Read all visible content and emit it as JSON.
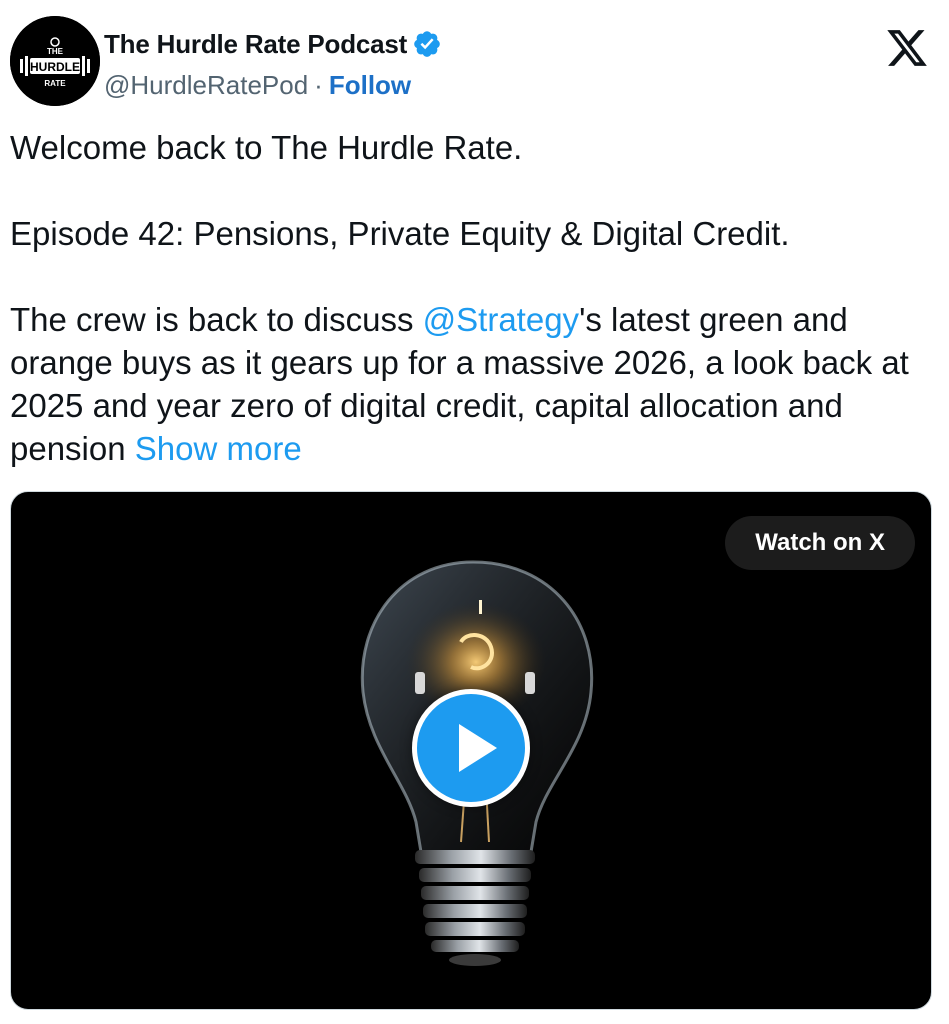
{
  "author": {
    "display_name": "The Hurdle Rate Podcast",
    "handle": "@HurdleRatePod",
    "separator": "·",
    "follow_label": "Follow",
    "avatar_text": [
      "THE",
      "HURDLE",
      "RATE"
    ],
    "verified": true
  },
  "tweet": {
    "line1": "Welcome back to The Hurdle Rate.",
    "line2": "Episode 42: Pensions, Private Equity & Digital Credit.",
    "para3_prefix": "The crew is back to discuss ",
    "mention": "@Strategy",
    "para3_rest": "'s latest green and orange buys as it gears up for a massive 2026, a look back at 2025 and year zero of digital credit, capital allocation and pension ",
    "show_more": "Show more"
  },
  "media": {
    "watch_label": "Watch on X"
  },
  "colors": {
    "link": "#1d9bf0",
    "follow": "#1d70c7",
    "verified": "#1d9bf0",
    "text": "#0f1419",
    "secondary": "#536471"
  },
  "icons": {
    "platform": "x-logo-icon",
    "verified": "verified-badge-icon",
    "play": "play-icon"
  }
}
